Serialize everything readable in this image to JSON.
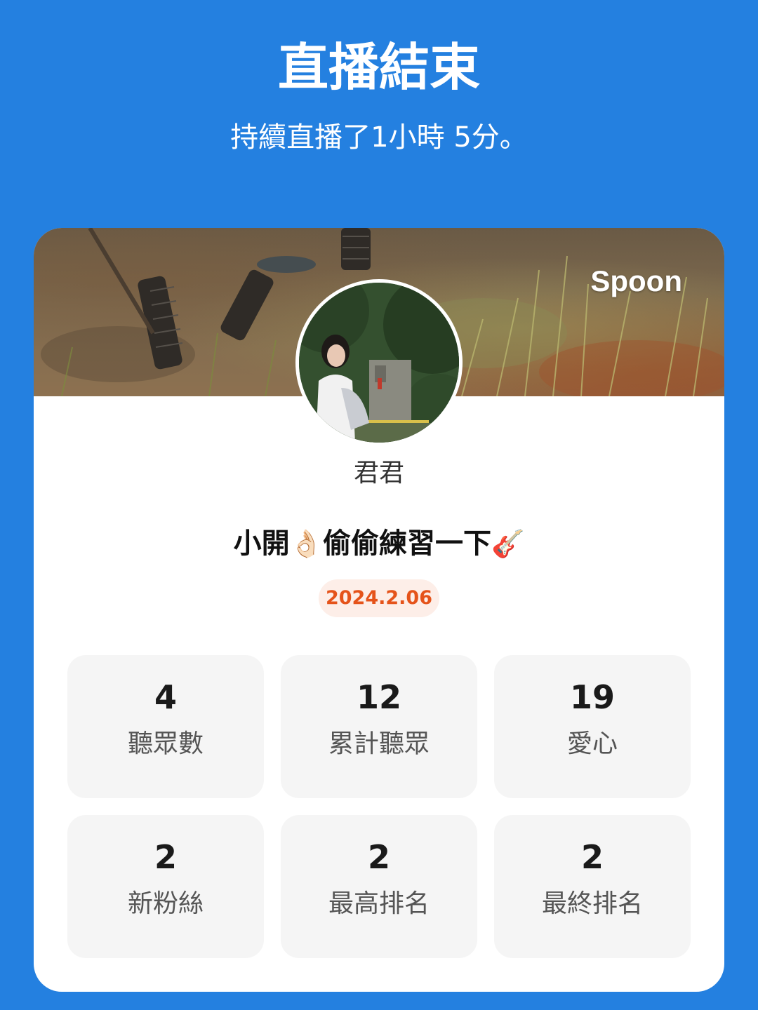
{
  "header": {
    "title": "直播結束",
    "subtitle": "持續直播了1小時 5分。"
  },
  "card": {
    "brand": "Spoon",
    "username": "君君",
    "live_title": {
      "part1": "小開",
      "emoji1": "👌🏻",
      "part2": "偷偷練習一下",
      "emoji2": "🎸"
    },
    "date": "2024.2.06",
    "stats": [
      {
        "value": "4",
        "label": "聽眾數"
      },
      {
        "value": "12",
        "label": "累計聽眾"
      },
      {
        "value": "19",
        "label": "愛心"
      },
      {
        "value": "2",
        "label": "新粉絲"
      },
      {
        "value": "2",
        "label": "最高排名"
      },
      {
        "value": "2",
        "label": "最終排名"
      }
    ]
  },
  "colors": {
    "background": "#2480E0",
    "card": "#FFFFFF",
    "stat_tile": "#F5F5F5",
    "date_text": "#E5531A",
    "date_bg": "#FDEEE8"
  }
}
